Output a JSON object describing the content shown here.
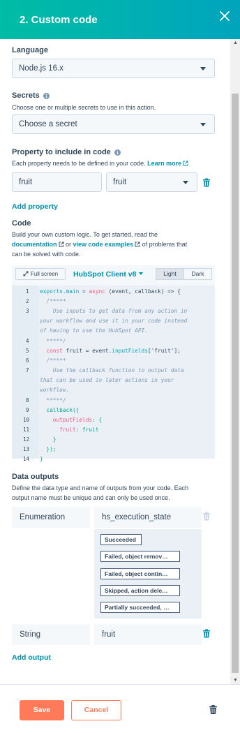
{
  "header": {
    "title": "2. Custom code"
  },
  "language": {
    "label": "Language",
    "value": "Node.js 16.x"
  },
  "secrets": {
    "label": "Secrets",
    "help": "Choose one or multiple secrets to use in this action.",
    "placeholder": "Choose a secret"
  },
  "property": {
    "label": "Property to include in code",
    "help": "Each property needs to be defined in your code.",
    "learn_more": "Learn more",
    "name_value": "fruit",
    "select_value": "fruit",
    "add_label": "Add property"
  },
  "code": {
    "label": "Code",
    "help_1": "Build your own custom logic. To get started, read the",
    "doc_link": "documentation",
    "or_text": "or",
    "examples_link": "view code examples",
    "help_2": "of problems that",
    "help_3": "can be solved with code.",
    "full_screen": "Full screen",
    "client": "HubSpot Client v8",
    "theme_light": "Light",
    "theme_dark": "Dark",
    "line_numbers": [
      "1",
      "2",
      "3",
      "4",
      "5",
      "6",
      "7",
      "8",
      "9",
      "10",
      "11",
      "12",
      "13",
      "14"
    ],
    "lines": {
      "l1a": "exports.",
      "l1b": "main",
      "l1c": " = ",
      "l1d": "async",
      "l1e": " (event, callback) => {",
      "l2": "  /*****",
      "l3a": "    Use inputs to get data from any action in",
      "l3b": "your workflow and use it in your code instead",
      "l3c": "of having to use the HubSpot API.",
      "l4": "  *****/",
      "l5a": "  const",
      "l5b": " fruit = event.",
      "l5c": "inputFields",
      "l5d": "['fruit'];",
      "l6": "  /*****",
      "l7a": "    Use the callback function to output data",
      "l7b": "that can be used in later actions in your",
      "l7c": "workflow.",
      "l8": "  *****/",
      "l9": "  callback({",
      "l10a": "    ",
      "l10b": "outputFields",
      "l10c": ": {",
      "l11a": "      ",
      "l11b": "fruit",
      "l11c": ": fruit",
      "l12": "    }",
      "l13": "  });",
      "l14": "}"
    }
  },
  "outputs": {
    "label": "Data outputs",
    "help_1": "Define the data type and name of outputs from your code. Each",
    "help_2": "output name must be unique and can only be used once.",
    "rows": [
      {
        "type": "Enumeration",
        "name": "hs_execution_state"
      },
      {
        "type": "String",
        "name": "fruit"
      }
    ],
    "options": [
      "Succeeded",
      "Failed, object remov…",
      "Failed, object contin…",
      "Skipped, action dele…",
      "Partially succeeded, …"
    ],
    "add_label": "Add output"
  },
  "footer": {
    "save": "Save",
    "cancel": "Cancel"
  },
  "colors": {
    "accent": "#00a4bd",
    "link": "#0091ae",
    "primary_button": "#ff7a59"
  }
}
